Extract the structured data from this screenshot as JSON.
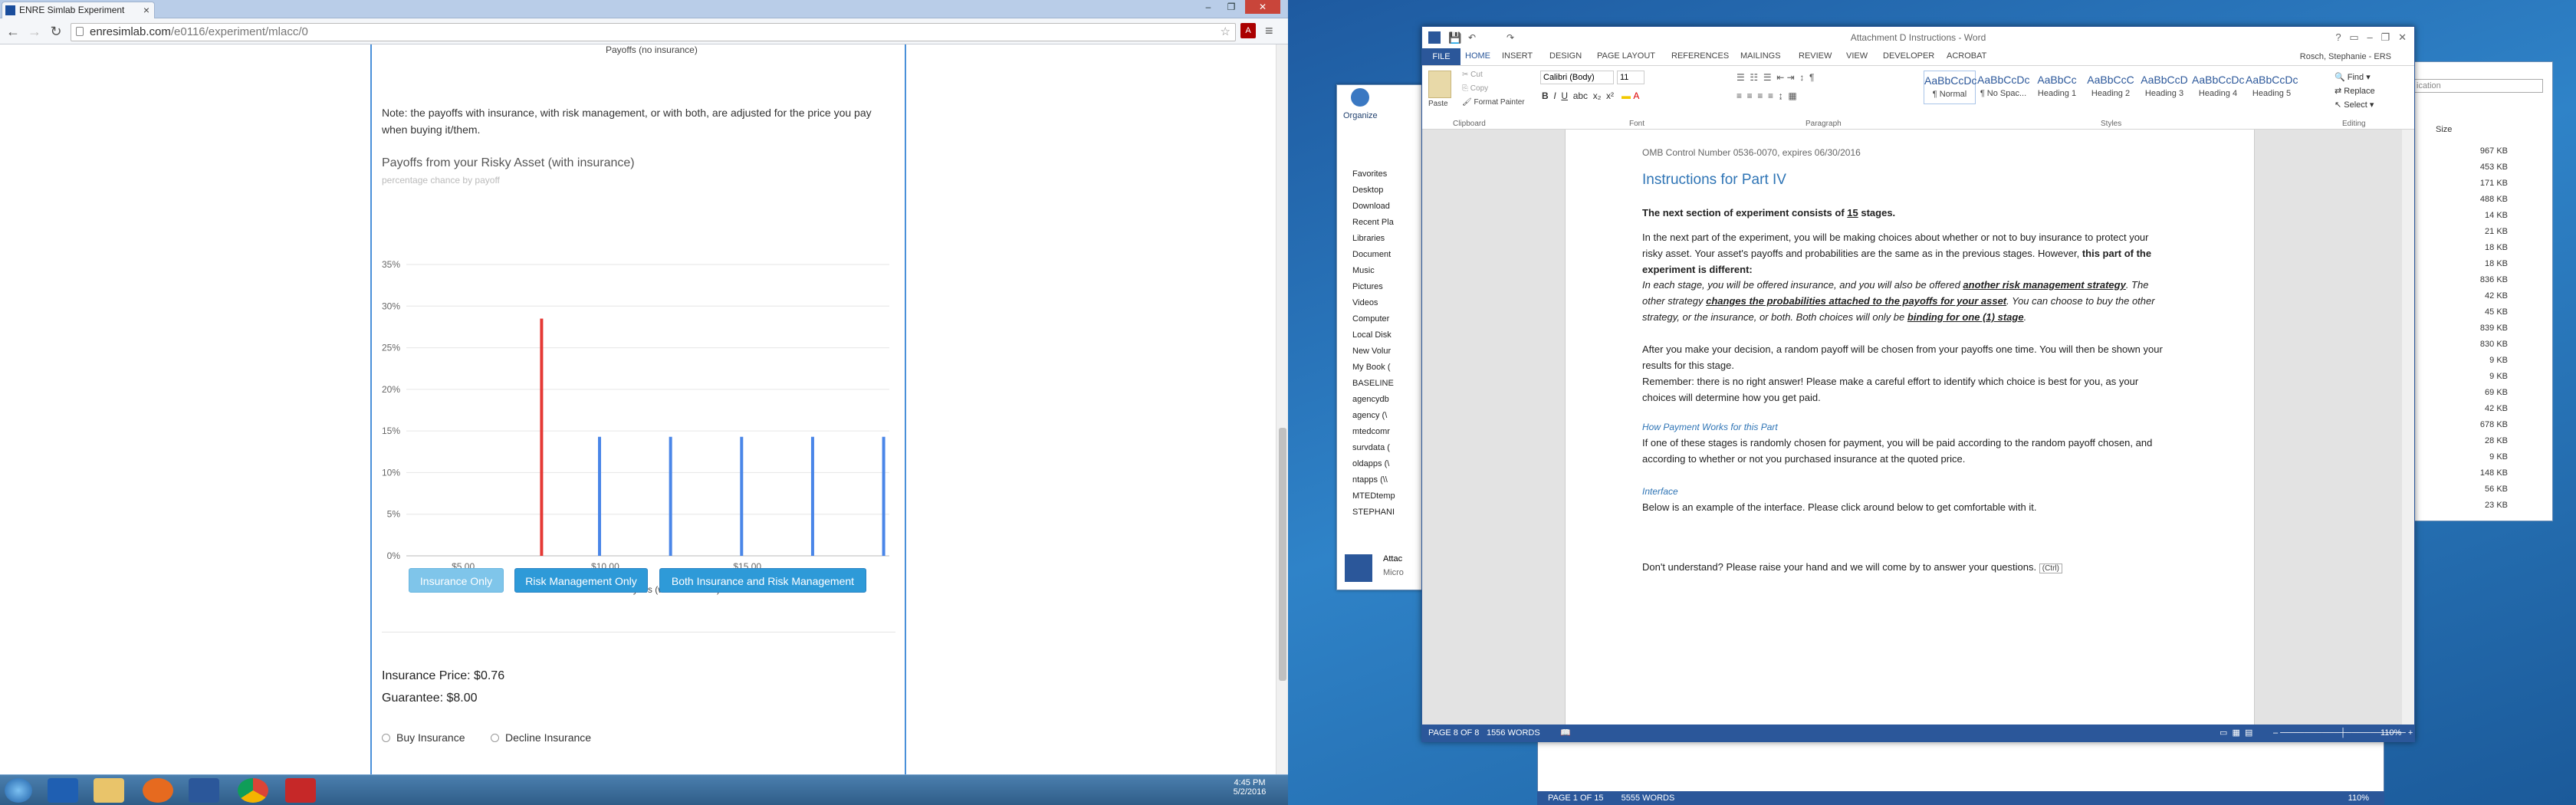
{
  "browser": {
    "tab_title": "ENRE Simlab Experiment",
    "url_host": "enresimlab.com",
    "url_path": "/e0116/experiment/mlacc/0",
    "pdf_badge": "A"
  },
  "experiment": {
    "top_axis_label": "Payoffs (no insurance)",
    "note": "Note: the payoffs with insurance, with risk management, or with both, are adjusted for the price you pay when buying it/them.",
    "chart_title": "Payoffs from your Risky Asset (with insurance)",
    "chart_subtitle": "percentage chance by payoff",
    "buttons": {
      "insurance_only": "Insurance Only",
      "risk_only": "Risk Management Only",
      "both": "Both Insurance and Risk Management"
    },
    "insurance_price": "Insurance Price: $0.76",
    "guarantee": "Guarantee: $8.00",
    "buy": "Buy Insurance",
    "decline": "Decline Insurance"
  },
  "chart_data": {
    "type": "bar",
    "title": "Payoffs from your Risky Asset (with insurance)",
    "subtitle": "percentage chance by payoff",
    "xlabel": "Payoffs (with insurance)",
    "ylabel": "",
    "x_ticks": [
      "$5.00",
      "$10.00",
      "$15.00"
    ],
    "y_ticks": [
      "0%",
      "5%",
      "10%",
      "15%",
      "20%",
      "25%",
      "30%",
      "35%"
    ],
    "ylim": [
      0,
      35
    ],
    "xlim": [
      3,
      20
    ],
    "series": [
      {
        "color": "#e53935",
        "points": [
          {
            "x": 7.76,
            "y": 28.5
          }
        ]
      },
      {
        "color": "#4a86e8",
        "points": [
          {
            "x": 9.8,
            "y": 14.3
          },
          {
            "x": 12.3,
            "y": 14.3
          },
          {
            "x": 14.8,
            "y": 14.3
          },
          {
            "x": 17.3,
            "y": 14.3
          },
          {
            "x": 19.8,
            "y": 14.3
          }
        ]
      }
    ]
  },
  "taskbar_left": {
    "time": "4:45 PM",
    "date": "5/2/2016"
  },
  "word": {
    "title": "Attachment D Instructions - Word",
    "user": "Rosch, Stephanie - ERS",
    "tabs": [
      "FILE",
      "HOME",
      "INSERT",
      "DESIGN",
      "PAGE LAYOUT",
      "REFERENCES",
      "MAILINGS",
      "REVIEW",
      "VIEW",
      "DEVELOPER",
      "ACROBAT"
    ],
    "font": "Calibri (Body)",
    "size": "11",
    "clipboard": {
      "paste": "Paste",
      "cut": "Cut",
      "copy": "Copy",
      "painter": "Format Painter"
    },
    "groups": {
      "clipboard": "Clipboard",
      "font": "Font",
      "paragraph": "Paragraph",
      "styles": "Styles",
      "editing": "Editing"
    },
    "styles": [
      {
        "pv": "AaBbCcDc",
        "name": "¶ Normal"
      },
      {
        "pv": "AaBbCcDc",
        "name": "¶ No Spac..."
      },
      {
        "pv": "AaBbCc",
        "name": "Heading 1"
      },
      {
        "pv": "AaBbCcC",
        "name": "Heading 2"
      },
      {
        "pv": "AaBbCcD",
        "name": "Heading 3"
      },
      {
        "pv": "AaBbCcDc",
        "name": "Heading 4"
      },
      {
        "pv": "AaBbCcDc",
        "name": "Heading 5"
      }
    ],
    "editing": {
      "find": "Find",
      "replace": "Replace",
      "select": "Select"
    },
    "doc": {
      "omb": "OMB Control Number 0536-0070, expires 06/30/2016",
      "heading": "Instructions for Part IV",
      "p1a": "The next section of experiment consists of ",
      "p1b": "15",
      "p1c": " stages.",
      "p2": "In the next part of the experiment, you will be making choices about whether or not to buy insurance to protect your risky asset. Your asset's payoffs and probabilities are the same as in the previous stages. However, ",
      "p2b": "this part of the experiment is different:",
      "p3a": "In each stage, you will be offered insurance, and you will also be offered ",
      "p3b": "another risk management strategy",
      "p3c": ".  The other strategy ",
      "p3d": "changes the probabilities attached to the payoffs for your asset",
      "p3e": ".  You can choose to buy the other strategy, or the insurance, or both. Both choices will only be ",
      "p3f": "binding for one (1) stage",
      "p3g": ".",
      "p4": "After you make your decision, a random payoff will be chosen from your payoffs one time. You will then be shown your results for this stage.",
      "p5": "Remember: there is no right answer! Please make a careful effort to identify which choice is best for you, as your choices will determine how you get paid.",
      "h2": "How Payment Works for this Part",
      "p6": "If one of these stages is randomly chosen for payment, you will be paid according to the random payoff chosen, and according to whether or not you purchased insurance at the quoted price.",
      "h3": "Interface",
      "p7": "Below is an example of the interface. Please click around below to get comfortable with it.",
      "p8": "Don't understand?  Please raise your hand and we will come by to answer your questions.",
      "ctrl": "(Ctrl)"
    },
    "status": {
      "page": "PAGE 8 OF 8",
      "words": "1556 WORDS",
      "zoom": "110%"
    },
    "status2": {
      "page": "PAGE 1 OF 15",
      "words": "5555 WORDS",
      "zoom": "110%"
    }
  },
  "explorer": {
    "organize": "Organize",
    "nav": [
      "Favorites",
      "Desktop",
      "Download",
      "Recent Pla",
      "Libraries",
      "Document",
      "Music",
      "Pictures",
      "Videos",
      "Computer",
      "Local Disk",
      "New Volur",
      "My Book (",
      "BASELINE",
      "agencydb",
      "agency (\\",
      "mtedcomr",
      "survdata (",
      "oldapps (\\",
      "ntapps (\\\\",
      "MTEDtemp",
      "STEPHANI"
    ],
    "attach": "Attac",
    "attach2": "Micro",
    "search": "ication",
    "col": "Size",
    "sizes": [
      "967 KB",
      "453 KB",
      "171 KB",
      "488 KB",
      "14 KB",
      "21 KB",
      "18 KB",
      "18 KB",
      "836 KB",
      "42 KB",
      "45 KB",
      "839 KB",
      "830 KB",
      "9 KB",
      "9 KB",
      "69 KB",
      "42 KB",
      "678 KB",
      "28 KB",
      "9 KB",
      "148 KB",
      "56 KB",
      "23 KB"
    ]
  }
}
